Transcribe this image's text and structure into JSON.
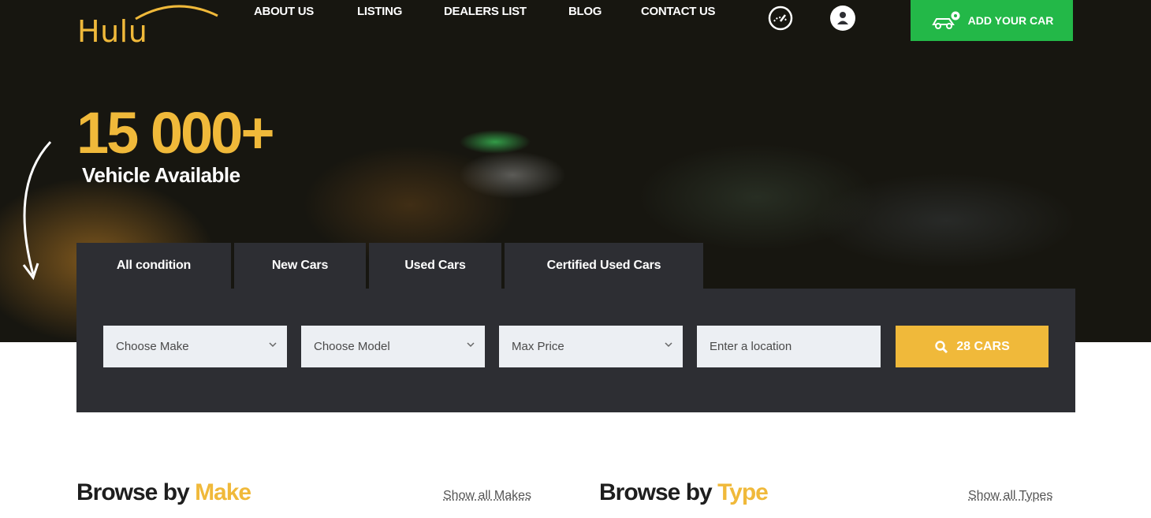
{
  "brand": {
    "logo_text": "Hulu",
    "accent_color": "#f0b93a",
    "green_color": "#23b848"
  },
  "nav": {
    "items": [
      {
        "label": "ABOUT US"
      },
      {
        "label": "LISTING"
      },
      {
        "label": "DEALERS LIST"
      },
      {
        "label": "BLOG"
      },
      {
        "label": "CONTACT US"
      }
    ],
    "icons": [
      "speedometer-icon",
      "user-icon"
    ],
    "add_car_label": "ADD YOUR CAR"
  },
  "hero": {
    "count": "15 000+",
    "subtitle": "Vehicle Available"
  },
  "search": {
    "tabs": [
      {
        "label": "All condition"
      },
      {
        "label": "New Cars"
      },
      {
        "label": "Used Cars"
      },
      {
        "label": "Certified Used Cars"
      }
    ],
    "make_value": "Choose Make",
    "model_value": "Choose Model",
    "price_value": "Max Price",
    "location_placeholder": "Enter a location",
    "button_label": "28 CARS"
  },
  "browse": {
    "make": {
      "prefix": "Browse by",
      "accent": "Make",
      "link": "Show all Makes"
    },
    "type": {
      "prefix": "Browse by",
      "accent": "Type",
      "link": "Show all Types"
    }
  }
}
